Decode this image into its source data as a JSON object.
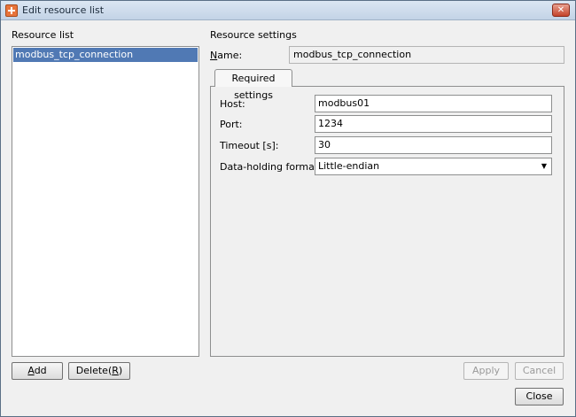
{
  "window": {
    "title": "Edit resource list",
    "close_glyph": "✕"
  },
  "resource_list": {
    "heading": "Resource list",
    "items": [
      {
        "label": "modbus_tcp_connection",
        "selected": true
      }
    ]
  },
  "buttons": {
    "add": "Add",
    "add_hint": "A",
    "delete_prefix": "Delete(",
    "delete_hint": "R",
    "delete_suffix": ")",
    "apply": "Apply",
    "cancel": "Cancel",
    "close": "Close"
  },
  "settings": {
    "heading": "Resource settings",
    "name_label": "Name:",
    "name_hint": "N",
    "name_label_rest": "ame:",
    "name_value": "modbus_tcp_connection",
    "tab": "Required settings",
    "fields": [
      {
        "label": "Host:",
        "value": "modbus01"
      },
      {
        "label": "Port:",
        "value": "1234"
      },
      {
        "label": "Timeout [s]:",
        "value": "30"
      }
    ],
    "format_label": "Data-holding format:",
    "format_value": "Little-endian"
  }
}
